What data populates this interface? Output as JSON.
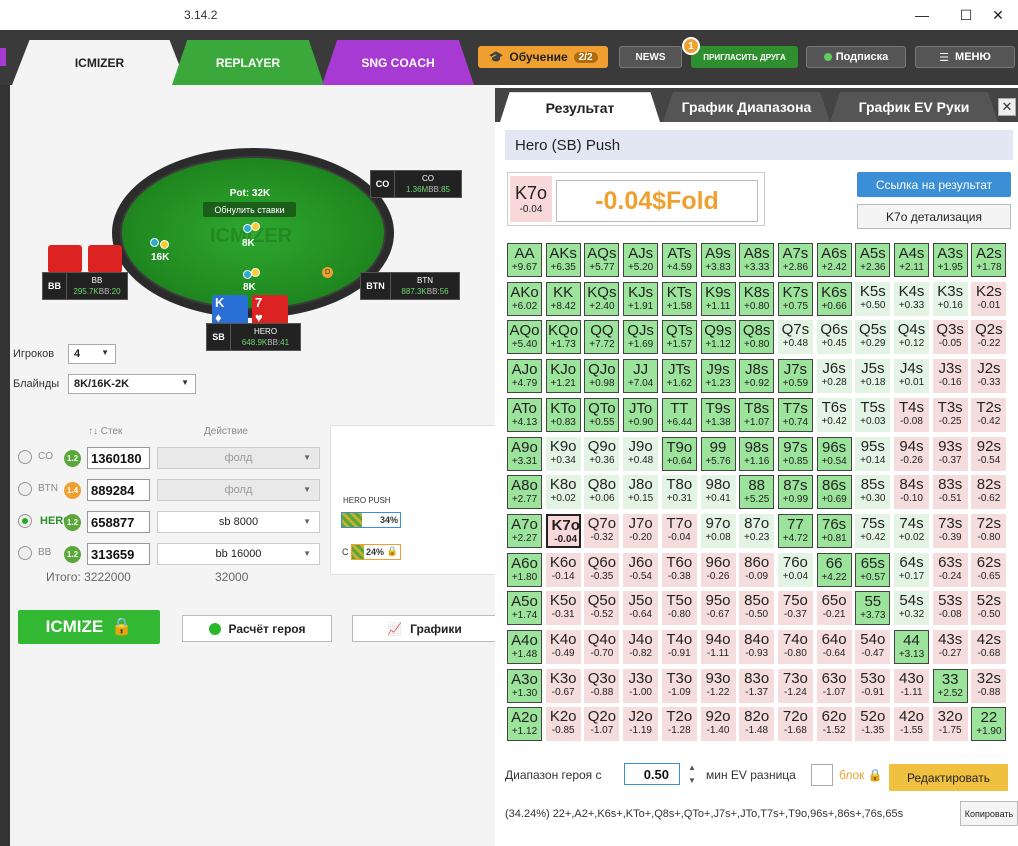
{
  "app": {
    "version": "3.14.2"
  },
  "window": {
    "minimize": "—",
    "maximize": "☐",
    "close": "✕"
  },
  "nav": {
    "tabs": [
      "ICMIZER",
      "REPLAYER",
      "SNG COACH"
    ],
    "learn_label": "Обучение",
    "learn_count": "2/2",
    "news": "NEWS",
    "invite": "ПРИГЛАСИТЬ ДРУГА",
    "invite_badge": "1",
    "subscription": "Подписка",
    "menu": "МЕНЮ"
  },
  "table": {
    "pot": "Pot: 32K",
    "reset_bets": "Обнулить ставки",
    "bet_left": "16K",
    "bet_top": "8K",
    "bet_hero": "8K",
    "logo_text": "ICMIZER",
    "dealer": "D",
    "seats": {
      "co": {
        "pos": "CO",
        "name": "CO",
        "stack": "1.36M",
        "bb": "85"
      },
      "bb": {
        "pos": "BB",
        "name": "BB",
        "stack": "295.7K",
        "bb": "20"
      },
      "btn": {
        "pos": "BTN",
        "name": "BTN",
        "stack": "887.3K",
        "bb": "56"
      },
      "hero": {
        "pos": "SB",
        "name": "HERO",
        "stack": "648.9K",
        "bb": "41"
      }
    },
    "hero_cards": [
      {
        "rank": "K",
        "suit": "♦"
      },
      {
        "rank": "7",
        "suit": "♥"
      }
    ]
  },
  "settings": {
    "players_label": "Игроков",
    "players_value": "4",
    "blinds_label": "Блайнды",
    "blinds_value": "8K/16K-2K"
  },
  "players_header": {
    "stack": "Стек",
    "action": "Действие"
  },
  "players": [
    {
      "pos": "CO",
      "badge": "1.2",
      "stack": "1360180",
      "action": "фолд",
      "selected": false
    },
    {
      "pos": "BTN",
      "badge": "1.4",
      "stack": "889284",
      "action": "фолд",
      "selected": false
    },
    {
      "pos": "HERO",
      "badge": "1.2",
      "stack": "658877",
      "action": "sb 8000",
      "selected": true
    },
    {
      "pos": "BB",
      "badge": "1.2",
      "stack": "313659",
      "action": "bb 16000",
      "selected": false
    }
  ],
  "totals": {
    "stack": "Итого: 3222000",
    "action": "32000"
  },
  "mini": {
    "title": "HERO PUSH",
    "push_pct": "34%",
    "call_label": "С",
    "call_pct": "24%",
    "push_frac": 0.34,
    "call_frac": 0.24
  },
  "buttons": {
    "icmize": "ICMIZE",
    "hero_calc": "Расчёт героя",
    "charts": "Графики"
  },
  "result": {
    "tabs": [
      "Результат",
      "График Диапазона",
      "График EV Руки"
    ],
    "title": "Hero (SB) Push",
    "hand": "K7o",
    "hand_ev": "-0.04",
    "outcome": "-0.04$Fold",
    "link_btn": "Ссылка на результат",
    "detail_btn": "K7o детализация",
    "range_label": "Диапазон героя с",
    "range_value": "0.50",
    "min_ev_label": "мин EV разница",
    "block_label": "блок",
    "edit_btn": "Редактировать",
    "range_string": "(34.24%) 22+,A2+,K6s+,KTo+,Q8s+,QTo+,J7s+,JTo,T7s+,T9o,96s+,86s+,76s,65s",
    "copy_btn": "Копировать"
  },
  "grid": [
    [
      [
        "AA",
        "+9.67",
        "p"
      ],
      [
        "AKs",
        "+6.35",
        "p"
      ],
      [
        "AQs",
        "+5.77",
        "p"
      ],
      [
        "AJs",
        "+5.20",
        "p"
      ],
      [
        "ATs",
        "+4.59",
        "p"
      ],
      [
        "A9s",
        "+3.83",
        "p"
      ],
      [
        "A8s",
        "+3.33",
        "p"
      ],
      [
        "A7s",
        "+2.86",
        "p"
      ],
      [
        "A6s",
        "+2.42",
        "p"
      ],
      [
        "A5s",
        "+2.36",
        "p"
      ],
      [
        "A4s",
        "+2.11",
        "p"
      ],
      [
        "A3s",
        "+1.95",
        "p"
      ],
      [
        "A2s",
        "+1.78",
        "p"
      ]
    ],
    [
      [
        "AKo",
        "+6.02",
        "p"
      ],
      [
        "KK",
        "+8.42",
        "p"
      ],
      [
        "KQs",
        "+2.40",
        "p"
      ],
      [
        "KJs",
        "+1.91",
        "p"
      ],
      [
        "KTs",
        "+1.58",
        "p"
      ],
      [
        "K9s",
        "+1.11",
        "p"
      ],
      [
        "K8s",
        "+0.80",
        "p"
      ],
      [
        "K7s",
        "+0.75",
        "p"
      ],
      [
        "K6s",
        "+0.66",
        "p"
      ],
      [
        "K5s",
        "+0.50",
        "g"
      ],
      [
        "K4s",
        "+0.33",
        "g"
      ],
      [
        "K3s",
        "+0.16",
        "g"
      ],
      [
        "K2s",
        "-0.01",
        "r"
      ]
    ],
    [
      [
        "AQo",
        "+5.40",
        "p"
      ],
      [
        "KQo",
        "+1.73",
        "p"
      ],
      [
        "QQ",
        "+7.72",
        "p"
      ],
      [
        "QJs",
        "+1.69",
        "p"
      ],
      [
        "QTs",
        "+1.57",
        "p"
      ],
      [
        "Q9s",
        "+1.12",
        "p"
      ],
      [
        "Q8s",
        "+0.80",
        "p"
      ],
      [
        "Q7s",
        "+0.48",
        "g"
      ],
      [
        "Q6s",
        "+0.45",
        "g"
      ],
      [
        "Q5s",
        "+0.29",
        "g"
      ],
      [
        "Q4s",
        "+0.12",
        "g"
      ],
      [
        "Q3s",
        "-0.05",
        "r"
      ],
      [
        "Q2s",
        "-0.22",
        "r"
      ]
    ],
    [
      [
        "AJo",
        "+4.79",
        "p"
      ],
      [
        "KJo",
        "+1.21",
        "p"
      ],
      [
        "QJo",
        "+0.98",
        "p"
      ],
      [
        "JJ",
        "+7.04",
        "p"
      ],
      [
        "JTs",
        "+1.62",
        "p"
      ],
      [
        "J9s",
        "+1.23",
        "p"
      ],
      [
        "J8s",
        "+0.92",
        "p"
      ],
      [
        "J7s",
        "+0.59",
        "p"
      ],
      [
        "J6s",
        "+0.28",
        "g"
      ],
      [
        "J5s",
        "+0.18",
        "g"
      ],
      [
        "J4s",
        "+0.01",
        "g"
      ],
      [
        "J3s",
        "-0.16",
        "r"
      ],
      [
        "J2s",
        "-0.33",
        "r"
      ]
    ],
    [
      [
        "ATo",
        "+4.13",
        "p"
      ],
      [
        "KTo",
        "+0.83",
        "p"
      ],
      [
        "QTo",
        "+0.55",
        "p"
      ],
      [
        "JTo",
        "+0.90",
        "p"
      ],
      [
        "TT",
        "+6.44",
        "p"
      ],
      [
        "T9s",
        "+1.38",
        "p"
      ],
      [
        "T8s",
        "+1.07",
        "p"
      ],
      [
        "T7s",
        "+0.74",
        "p"
      ],
      [
        "T6s",
        "+0.42",
        "g"
      ],
      [
        "T5s",
        "+0.03",
        "g"
      ],
      [
        "T4s",
        "-0.08",
        "r"
      ],
      [
        "T3s",
        "-0.25",
        "r"
      ],
      [
        "T2s",
        "-0.42",
        "r"
      ]
    ],
    [
      [
        "A9o",
        "+3.31",
        "p"
      ],
      [
        "K9o",
        "+0.34",
        "g"
      ],
      [
        "Q9o",
        "+0.36",
        "g"
      ],
      [
        "J9o",
        "+0.48",
        "g"
      ],
      [
        "T9o",
        "+0.64",
        "p"
      ],
      [
        "99",
        "+5.76",
        "p"
      ],
      [
        "98s",
        "+1.16",
        "p"
      ],
      [
        "97s",
        "+0.85",
        "p"
      ],
      [
        "96s",
        "+0.54",
        "p"
      ],
      [
        "95s",
        "+0.14",
        "g"
      ],
      [
        "94s",
        "-0.26",
        "r"
      ],
      [
        "93s",
        "-0.37",
        "r"
      ],
      [
        "92s",
        "-0.54",
        "r"
      ]
    ],
    [
      [
        "A8o",
        "+2.77",
        "p"
      ],
      [
        "K8o",
        "+0.02",
        "g"
      ],
      [
        "Q8o",
        "+0.06",
        "g"
      ],
      [
        "J8o",
        "+0.15",
        "g"
      ],
      [
        "T8o",
        "+0.31",
        "g"
      ],
      [
        "98o",
        "+0.41",
        "g"
      ],
      [
        "88",
        "+5.25",
        "p"
      ],
      [
        "87s",
        "+0.99",
        "p"
      ],
      [
        "86s",
        "+0.69",
        "p"
      ],
      [
        "85s",
        "+0.30",
        "g"
      ],
      [
        "84s",
        "-0.10",
        "r"
      ],
      [
        "83s",
        "-0.51",
        "r"
      ],
      [
        "82s",
        "-0.62",
        "r"
      ]
    ],
    [
      [
        "A7o",
        "+2.27",
        "p"
      ],
      [
        "K7o",
        "-0.04",
        "s"
      ],
      [
        "Q7o",
        "-0.32",
        "r"
      ],
      [
        "J7o",
        "-0.20",
        "r"
      ],
      [
        "T7o",
        "-0.04",
        "r"
      ],
      [
        "97o",
        "+0.08",
        "g"
      ],
      [
        "87o",
        "+0.23",
        "g"
      ],
      [
        "77",
        "+4.72",
        "p"
      ],
      [
        "76s",
        "+0.81",
        "p"
      ],
      [
        "75s",
        "+0.42",
        "g"
      ],
      [
        "74s",
        "+0.02",
        "g"
      ],
      [
        "73s",
        "-0.39",
        "r"
      ],
      [
        "72s",
        "-0.80",
        "r"
      ]
    ],
    [
      [
        "A6o",
        "+1.80",
        "p"
      ],
      [
        "K6o",
        "-0.14",
        "r"
      ],
      [
        "Q6o",
        "-0.35",
        "r"
      ],
      [
        "J6o",
        "-0.54",
        "r"
      ],
      [
        "T6o",
        "-0.38",
        "r"
      ],
      [
        "96o",
        "-0.26",
        "r"
      ],
      [
        "86o",
        "-0.09",
        "r"
      ],
      [
        "76o",
        "+0.04",
        "g"
      ],
      [
        "66",
        "+4.22",
        "p"
      ],
      [
        "65s",
        "+0.57",
        "p"
      ],
      [
        "64s",
        "+0.17",
        "g"
      ],
      [
        "63s",
        "-0.24",
        "r"
      ],
      [
        "62s",
        "-0.65",
        "r"
      ]
    ],
    [
      [
        "A5o",
        "+1.74",
        "p"
      ],
      [
        "K5o",
        "-0.31",
        "r"
      ],
      [
        "Q5o",
        "-0.52",
        "r"
      ],
      [
        "J5o",
        "-0.64",
        "r"
      ],
      [
        "T5o",
        "-0.80",
        "r"
      ],
      [
        "95o",
        "-0.67",
        "r"
      ],
      [
        "85o",
        "-0.50",
        "r"
      ],
      [
        "75o",
        "-0.37",
        "r"
      ],
      [
        "65o",
        "-0.21",
        "r"
      ],
      [
        "55",
        "+3.73",
        "p"
      ],
      [
        "54s",
        "+0.32",
        "g"
      ],
      [
        "53s",
        "-0.08",
        "r"
      ],
      [
        "52s",
        "-0.50",
        "r"
      ]
    ],
    [
      [
        "A4o",
        "+1.48",
        "p"
      ],
      [
        "K4o",
        "-0.49",
        "r"
      ],
      [
        "Q4o",
        "-0.70",
        "r"
      ],
      [
        "J4o",
        "-0.82",
        "r"
      ],
      [
        "T4o",
        "-0.91",
        "r"
      ],
      [
        "94o",
        "-1.11",
        "r"
      ],
      [
        "84o",
        "-0.93",
        "r"
      ],
      [
        "74o",
        "-0.80",
        "r"
      ],
      [
        "64o",
        "-0.64",
        "r"
      ],
      [
        "54o",
        "-0.47",
        "r"
      ],
      [
        "44",
        "+3.13",
        "p"
      ],
      [
        "43s",
        "-0.27",
        "r"
      ],
      [
        "42s",
        "-0.68",
        "r"
      ]
    ],
    [
      [
        "A3o",
        "+1.30",
        "p"
      ],
      [
        "K3o",
        "-0.67",
        "r"
      ],
      [
        "Q3o",
        "-0.88",
        "r"
      ],
      [
        "J3o",
        "-1.00",
        "r"
      ],
      [
        "T3o",
        "-1.09",
        "r"
      ],
      [
        "93o",
        "-1.22",
        "r"
      ],
      [
        "83o",
        "-1.37",
        "r"
      ],
      [
        "73o",
        "-1.24",
        "r"
      ],
      [
        "63o",
        "-1.07",
        "r"
      ],
      [
        "53o",
        "-0.91",
        "r"
      ],
      [
        "43o",
        "-1.11",
        "r"
      ],
      [
        "33",
        "+2.52",
        "p"
      ],
      [
        "32s",
        "-0.88",
        "r"
      ]
    ],
    [
      [
        "A2o",
        "+1.12",
        "p"
      ],
      [
        "K2o",
        "-0.85",
        "r"
      ],
      [
        "Q2o",
        "-1.07",
        "r"
      ],
      [
        "J2o",
        "-1.19",
        "r"
      ],
      [
        "T2o",
        "-1.28",
        "r"
      ],
      [
        "92o",
        "-1.40",
        "r"
      ],
      [
        "82o",
        "-1.48",
        "r"
      ],
      [
        "72o",
        "-1.68",
        "r"
      ],
      [
        "62o",
        "-1.52",
        "r"
      ],
      [
        "52o",
        "-1.35",
        "r"
      ],
      [
        "42o",
        "-1.55",
        "r"
      ],
      [
        "32o",
        "-1.75",
        "r"
      ],
      [
        "22",
        "+1.90",
        "p"
      ]
    ]
  ]
}
